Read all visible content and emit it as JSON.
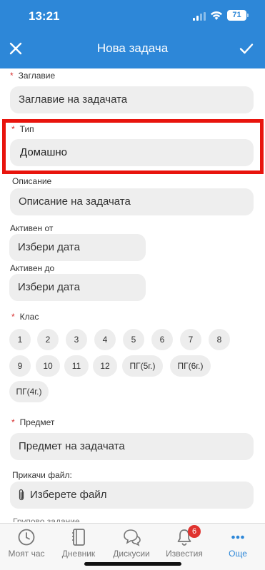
{
  "status_bar": {
    "time": "13:21",
    "battery": "71"
  },
  "header": {
    "title": "Нова задача",
    "close_icon": "close-icon",
    "confirm_icon": "checkmark-icon"
  },
  "form": {
    "title": {
      "label": "Заглавие",
      "placeholder": "Заглавие на задачата",
      "required": true
    },
    "type": {
      "label": "Тип",
      "value": "Домашно",
      "required": true
    },
    "description": {
      "label": "Описание",
      "placeholder": "Описание на задачата"
    },
    "active_from": {
      "label": "Активен от",
      "placeholder": "Избери дата"
    },
    "active_to": {
      "label": "Активен до",
      "placeholder": "Избери дата"
    },
    "class": {
      "label": "Клас",
      "required": true,
      "options": [
        "1",
        "2",
        "3",
        "4",
        "5",
        "6",
        "7",
        "8",
        "9",
        "10",
        "11",
        "12",
        "ПГ(5г.)",
        "ПГ(6г.)",
        "ПГ(4г.)"
      ]
    },
    "subject": {
      "label": "Предмет",
      "placeholder": "Предмет на задачата",
      "required": true
    },
    "attach": {
      "label": "Прикачи файл:",
      "button": "Изберете файл"
    },
    "next_section_peek": "Групово задание"
  },
  "tabbar": {
    "items": [
      {
        "label": "Моят час",
        "icon": "clock-icon"
      },
      {
        "label": "Дневник",
        "icon": "notebook-icon"
      },
      {
        "label": "Дискусии",
        "icon": "chat-bubbles-icon"
      },
      {
        "label": "Известия",
        "icon": "bell-icon",
        "badge": "6"
      },
      {
        "label": "Още",
        "icon": "more-dots-icon",
        "active": true
      }
    ]
  },
  "colors": {
    "accent": "#2d87d8",
    "required": "#d62e2e",
    "highlight": "#e8140d",
    "badge": "#e0332f"
  }
}
